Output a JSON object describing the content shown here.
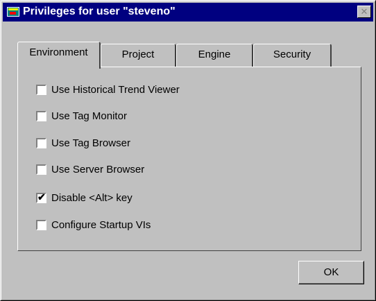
{
  "window": {
    "title": "Privileges for user \"steveno\"",
    "close_label": "✕"
  },
  "tabs": [
    {
      "label": "Environment",
      "active": true
    },
    {
      "label": "Project",
      "active": false
    },
    {
      "label": "Engine",
      "active": false
    },
    {
      "label": "Security",
      "active": false
    }
  ],
  "options": [
    {
      "label": "Use Historical Trend Viewer",
      "checked": false
    },
    {
      "label": "Use Tag Monitor",
      "checked": false
    },
    {
      "label": "Use Tag Browser",
      "checked": false
    },
    {
      "label": "Use Server Browser",
      "checked": false
    },
    {
      "label": "Disable <Alt> key",
      "checked": true
    },
    {
      "label": "Configure Startup VIs",
      "checked": false
    }
  ],
  "check_mark": "✔",
  "buttons": {
    "ok_label": "OK"
  }
}
